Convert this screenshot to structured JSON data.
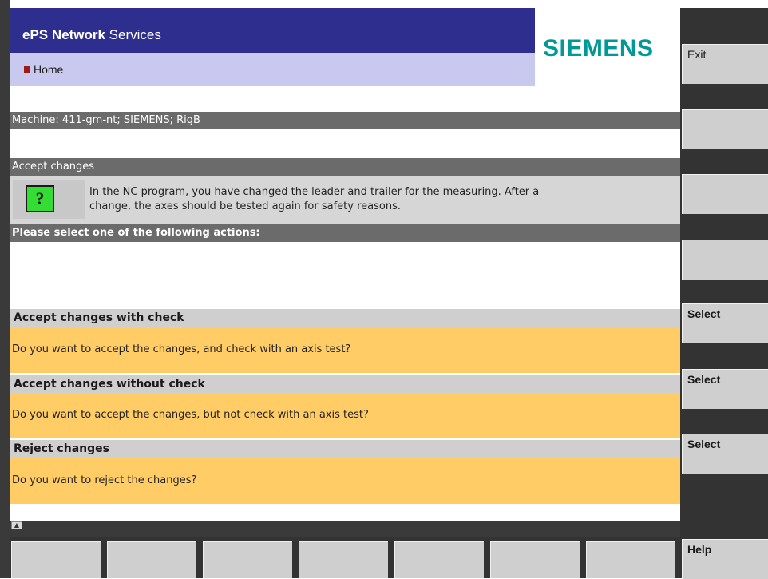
{
  "header": {
    "title_bold": "ePS Network",
    "title_rest": " Services",
    "home_link": "Home",
    "logo": "SIEMENS"
  },
  "machine": {
    "label": "Machine: 411-gm-nt; SIEMENS; RigB"
  },
  "accept_section": {
    "title": "Accept changes",
    "icon": "question-mark-icon",
    "icon_glyph": "?",
    "message_line1": "In the NC program, you have changed the leader and trailer for the measuring. After a",
    "message_line2": "change, the axes should be tested again for safety reasons."
  },
  "actions_prompt": "Please select one of the following actions:",
  "options": [
    {
      "title": "Accept changes with check",
      "question": "Do you want to accept the changes, and check with an axis test?"
    },
    {
      "title": "Accept changes without check",
      "question": "Do you want to accept the changes, but not check with an axis test?"
    },
    {
      "title": "Reject changes",
      "question": "Do you want to reject the changes?"
    }
  ],
  "softkeys": {
    "exit": "Exit",
    "select1": "Select",
    "select2": "Select",
    "select3": "Select",
    "help": "Help"
  },
  "colors": {
    "header_blue": "#2e2e8e",
    "home_band": "#c9c9f0",
    "logo_teal": "#009999",
    "section_gray": "#6b6b6b",
    "option_orange": "#ffcc66",
    "question_green": "#33dd33"
  }
}
